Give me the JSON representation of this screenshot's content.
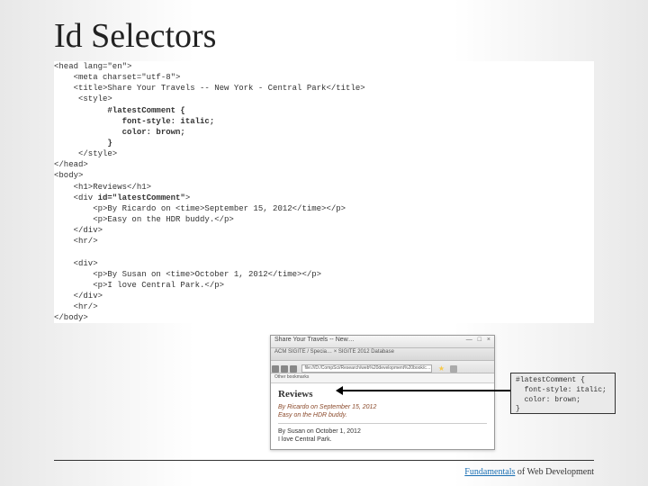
{
  "title": "Id Selectors",
  "code": {
    "l1": "<head lang=\"en\">",
    "l2": "    <meta charset=\"utf-8\">",
    "l3": "    <title>Share Your Travels -- New York - Central Park</title>",
    "l4": "     <style>",
    "l5": "           #latestComment {",
    "l6": "              font-style: italic;",
    "l7": "              color: brown;",
    "l8": "           }",
    "l9": "     </style>",
    "l10": "</head>",
    "l11": "<body>",
    "l12": "    <h1>Reviews</h1>",
    "l13a": "    <div ",
    "l13b": "id=\"latestComment\"",
    "l13c": ">",
    "l14": "        <p>By Ricardo on <time>September 15, 2012</time></p>",
    "l15": "        <p>Easy on the HDR buddy.</p>",
    "l16": "    </div>",
    "l17": "    <hr/>",
    "blank": "",
    "l18": "    <div>",
    "l19": "        <p>By Susan on <time>October 1, 2012</time></p>",
    "l20": "        <p>I love Central Park.</p>",
    "l21": "    </div>",
    "l22": "    <hr/>",
    "l23": "</body>"
  },
  "browser": {
    "window_title": "Share Your Travels -- New…",
    "tab1": "ACM SIGITE / Specia…",
    "tab2": "SIGITE 2012 Database",
    "url": "file:///D:/CompSci/Research/web%20development%20book/c…",
    "bookmark": "Other bookmarks",
    "heading": "Reviews",
    "latest_by": "By Ricardo on September 15, 2012",
    "latest_text": "Easy on the HDR buddy.",
    "normal_by": "By Susan on October 1, 2012",
    "normal_text": "I love Central Park."
  },
  "css_box": "#latestComment {\n  font-style: italic;\n  color: brown;\n}",
  "footer": {
    "fundamentals": "Fundamentals",
    "rest": " of Web Development"
  }
}
